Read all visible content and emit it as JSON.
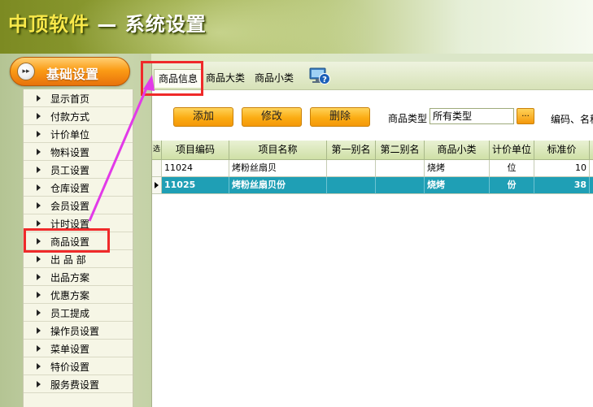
{
  "window": {
    "brand": "中顶软件",
    "title": " — 系统设置"
  },
  "sidebar": {
    "section_title": "基础设置",
    "items": [
      {
        "label": "显示首页"
      },
      {
        "label": "付款方式"
      },
      {
        "label": "计价单位"
      },
      {
        "label": "物料设置"
      },
      {
        "label": "员工设置"
      },
      {
        "label": "仓库设置"
      },
      {
        "label": "会员设置"
      },
      {
        "label": "计时设置"
      },
      {
        "label": "商品设置"
      },
      {
        "label": "出 品 部"
      },
      {
        "label": "出品方案"
      },
      {
        "label": "优惠方案"
      },
      {
        "label": "员工提成"
      },
      {
        "label": "操作员设置"
      },
      {
        "label": "菜单设置"
      },
      {
        "label": "特价设置"
      },
      {
        "label": "服务费设置"
      }
    ]
  },
  "tabs": [
    {
      "label": "商品信息"
    },
    {
      "label": "商品大类"
    },
    {
      "label": "商品小类"
    }
  ],
  "toolbar": {
    "add_label": "添加",
    "edit_label": "修改",
    "delete_label": "删除",
    "type_label": "商品类型",
    "type_value": "所有类型",
    "dots_label": "...",
    "search_label": "编码、名称"
  },
  "grid": {
    "corner_label": "选",
    "columns": [
      "项目编码",
      "项目名称",
      "第一别名",
      "第二别名",
      "商品小类",
      "计价单位",
      "标准价"
    ],
    "rows": [
      {
        "code": "11024",
        "name": "烤粉丝扇贝",
        "alias1": "",
        "alias2": "",
        "category": "烧烤",
        "unit": "位",
        "price": "10"
      },
      {
        "code": "11025",
        "name": "烤粉丝扇贝份",
        "alias1": "",
        "alias2": "",
        "category": "烧烤",
        "unit": "份",
        "price": "38"
      }
    ]
  },
  "colors": {
    "accent_orange": "#fb9c16",
    "selected_row": "#1f9fb5",
    "annotation_red": "#ef2a2a",
    "annotation_arrow": "#e23ae8"
  }
}
